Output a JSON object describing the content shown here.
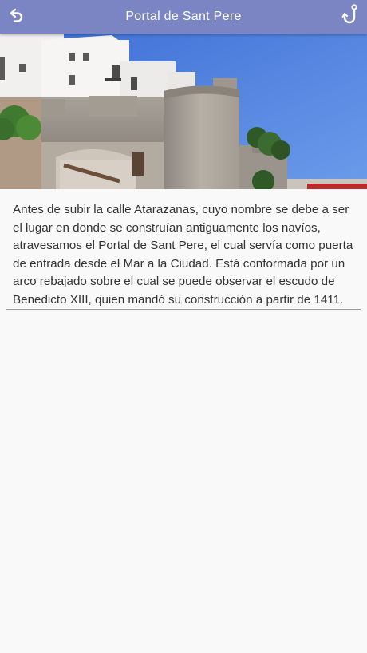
{
  "header": {
    "title": "Portal de Sant Pere",
    "back_icon": "back-arrow-icon",
    "right_icon": "hook-icon",
    "background": "#7b85c4"
  },
  "hero_image": {
    "subject": "Portal de Sant Pere stone gateway and walls"
  },
  "content": {
    "description": "Antes de subir la calle Atarazanas, cuyo nombre se debe a ser el lugar en donde se construían antiguamente los navíos, atravesamos el Portal de Sant Pere, el cual servía como puerta de entrada desde el Mar a la Ciudad. Está conformada por un arco rebajado sobre el cual se puede observar el escudo de Benedicto XIII, quien mandó su construcción a partir de 1411."
  }
}
